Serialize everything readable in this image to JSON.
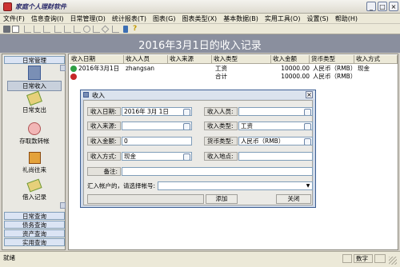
{
  "window": {
    "title": "家庭个人理财软件"
  },
  "menu": [
    "文件(F)",
    "信息查询(I)",
    "日常管理(D)",
    "统计报表(T)",
    "图表(G)",
    "图表类型(X)",
    "基本数据(B)",
    "实用工具(O)",
    "设置(S)",
    "帮助(H)"
  ],
  "banner": {
    "title": "2016年3月1日的收入记录"
  },
  "sidebar": {
    "header": "日常管理",
    "items": [
      "日常收入",
      "日常支出",
      "存取款转帐",
      "礼尚往来",
      "借入记录"
    ],
    "footer": [
      "日常查询",
      "债务查询",
      "资产查询",
      "实用查询"
    ]
  },
  "grid": {
    "columns": [
      "收入日期",
      "收入人员",
      "收入来源",
      "收入类型",
      "收入金额",
      "货币类型",
      "收入方式"
    ],
    "rows": [
      [
        "2016年3月1日",
        "zhangsan",
        "",
        "工资",
        "10000.00",
        "人民币（RMB）",
        "现金"
      ],
      [
        "",
        "",
        "",
        "合计",
        "10000.00",
        "人民币（RMB）",
        ""
      ]
    ]
  },
  "dialog": {
    "title": "收入",
    "fields": {
      "date_label": "收入日期:",
      "date_value": "2016年 3月 1日",
      "person_label": "收入人员:",
      "person_value": "",
      "source_label": "收入来源:",
      "source_value": "",
      "type_label": "收入类型:",
      "type_value": "工资",
      "amount_label": "收入金额:",
      "amount_value": "0",
      "currency_label": "货币类型:",
      "currency_value": "人民币（RMB）",
      "method_label": "收入方式:",
      "method_value": "现金",
      "place_label": "收入地点:",
      "place_value": "",
      "note_label": "备注:",
      "note_value": "",
      "account_label": "汇入帐户的，请选择帐号:",
      "account_value": ""
    },
    "add_button": "添加",
    "close_button": "关闭"
  },
  "status": {
    "left": "就绪",
    "right": "数字"
  }
}
